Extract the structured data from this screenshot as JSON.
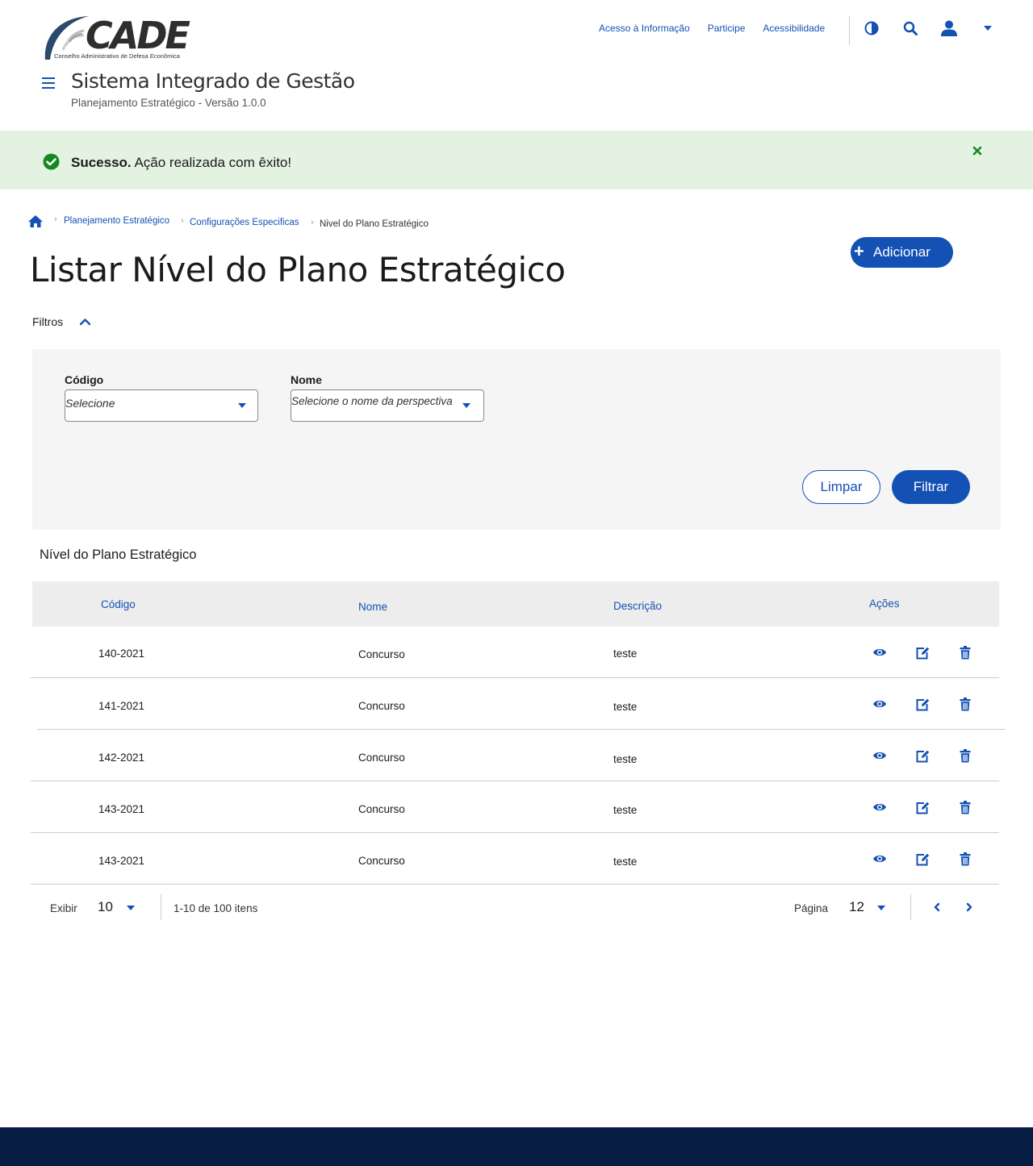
{
  "header": {
    "logo_text": "CADE",
    "logo_subtitle": "Conselho Administrativo de Defesa Econômica",
    "links": [
      "Acesso à Informação",
      "Participe",
      "Acessibilidade"
    ],
    "system_title": "Sistema Integrado de Gestão",
    "system_subtitle": "Planejamento Estratégico - Versão 1.0.0",
    "icons": [
      "contrast-icon",
      "search-icon",
      "user-icon",
      "chevron-down-icon"
    ],
    "accent_color": "#1351b4"
  },
  "alert": {
    "title": "Sucesso.",
    "message": "Ação realizada com êxito!",
    "background_color": "#e3f2e1",
    "icon_color": "#168821"
  },
  "breadcrumb": [
    "Planejamento Estratégico",
    "Configurações Especificas",
    "Nivel do Plano Estratégico"
  ],
  "page": {
    "title": "Listar Nível do Plano Estratégico",
    "add_button": "Adicionar"
  },
  "filters": {
    "toggle_label": "Filtros",
    "codigo_label": "Código",
    "codigo_value": "Selecione",
    "nome_label": "Nome",
    "nome_value": "Selecione o nome da perspectiva",
    "clear_button": "Limpar",
    "filter_button": "Filtrar"
  },
  "table": {
    "title": "Nível do Plano Estratégico",
    "columns": [
      "Código",
      "Nome",
      "Descrição",
      "Ações"
    ],
    "rows": [
      {
        "codigo": "140-2021",
        "nome": "Concurso",
        "descricao": "teste"
      },
      {
        "codigo": "141-2021",
        "nome": "Concurso",
        "descricao": "teste"
      },
      {
        "codigo": "142-2021",
        "nome": "Concurso",
        "descricao": "teste"
      },
      {
        "codigo": "143-2021",
        "nome": "Concurso",
        "descricao": "teste"
      },
      {
        "codigo": "143-2021",
        "nome": "Concurso",
        "descricao": "teste"
      }
    ],
    "action_icons": [
      "eye-icon",
      "edit-icon",
      "trash-icon"
    ]
  },
  "pagination": {
    "show_label": "Exibir",
    "page_size": "10",
    "range_text": "1-10 de 100 itens",
    "page_label": "Página",
    "page_number": "12"
  },
  "footer": {
    "background_color": "#071d41"
  }
}
